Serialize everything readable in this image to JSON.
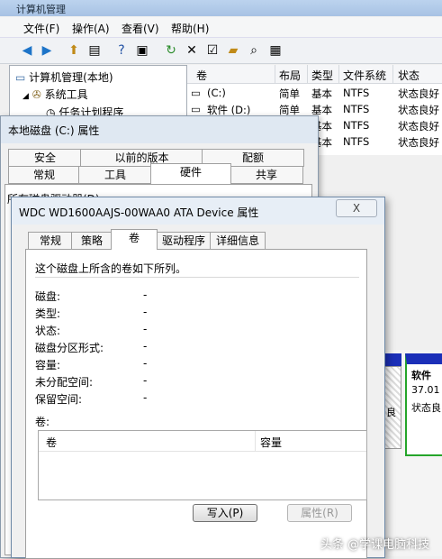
{
  "main_window": {
    "title": "计算机管理",
    "menu": [
      "文件(F)",
      "操作(A)",
      "查看(V)",
      "帮助(H)"
    ],
    "tree": [
      "计算机管理(本地)",
      "系统工具",
      "任务计划程序"
    ],
    "columns": [
      "卷",
      "布局",
      "类型",
      "文件系统",
      "状态"
    ],
    "volumes": [
      {
        "name": "(C:)",
        "layout": "简单",
        "type": "基本",
        "fs": "NTFS",
        "status": "状态良好"
      },
      {
        "name": "软件 (D:)",
        "layout": "简单",
        "type": "基本",
        "fs": "NTFS",
        "status": "状态良好"
      },
      {
        "name": "",
        "layout": "简单",
        "type": "基本",
        "fs": "NTFS",
        "status": "状态良好"
      },
      {
        "name": "",
        "layout": "简单",
        "type": "基本",
        "fs": "NTFS",
        "status": "状态良好"
      }
    ],
    "graph_partition": {
      "name": "软件",
      "size": "37.01",
      "status": "状态良"
    },
    "graph_left_text": "良"
  },
  "c_props": {
    "title": "本地磁盘 (C:) 属性",
    "tabs_row1": [
      "安全",
      "以前的版本",
      "配额"
    ],
    "tabs_row2": [
      "常规",
      "工具",
      "硬件",
      "共享"
    ],
    "partial_text": "所有磁盘驱动器(D):"
  },
  "device_dialog": {
    "title": "WDC WD1600AAJS-00WAA0 ATA Device 属性",
    "close_label": "X",
    "tabs": [
      "常规",
      "策略",
      "卷",
      "驱动程序",
      "详细信息"
    ],
    "active_tab": "卷",
    "intro": "这个磁盘上所含的卷如下所列。",
    "fields": [
      {
        "label": "磁盘:",
        "value": "-"
      },
      {
        "label": "类型:",
        "value": "-"
      },
      {
        "label": "状态:",
        "value": "-"
      },
      {
        "label": "磁盘分区形式:",
        "value": "-"
      },
      {
        "label": "容量:",
        "value": "-"
      },
      {
        "label": "未分配空间:",
        "value": "-"
      },
      {
        "label": "保留空间:",
        "value": "-"
      }
    ],
    "volumes_label": "卷:",
    "volume_columns": [
      "卷",
      "容量"
    ],
    "populate_button": "写入(P)",
    "properties_button": "属性(R)"
  },
  "watermark": "头条 @学课电脑科技"
}
